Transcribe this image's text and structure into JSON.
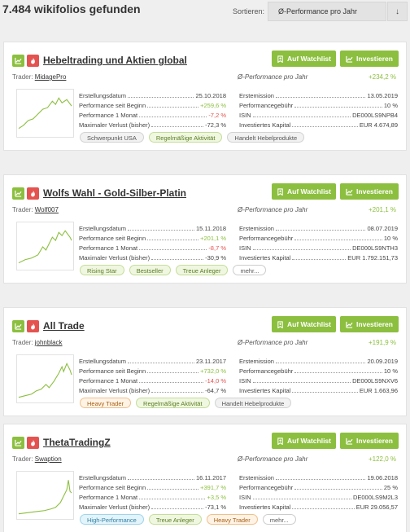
{
  "header": {
    "result_title": "7.484 wikifolios gefunden",
    "sort_label": "Sortieren:",
    "sort_value": "Ø-Performance pro Jahr"
  },
  "labels": {
    "watch": "Auf Watchlist",
    "invest": "Investieren",
    "trader": "Trader:",
    "perf_year": "Ø-Performance pro Jahr",
    "created": "Erstellungsdatum",
    "perf_start": "Performance seit Beginn",
    "perf_month": "Performance 1 Monat",
    "max_loss": "Maximaler Verlust (bisher)",
    "emission": "Erstemission",
    "fee": "Performancegebühr",
    "isin": "ISIN",
    "capital": "Investiertes Kapital"
  },
  "colors": {
    "accent": "#8cbf3f",
    "negative": "#e4534f"
  },
  "cards": [
    {
      "title": "Hebeltrading und Aktien global",
      "trader": "MidagePro",
      "perf_year": "+234,2 %",
      "created": "25.10.2018",
      "perf_start": "+259,6 %",
      "perf_month": "-7,2 %",
      "max_loss": "-72,3 %",
      "emission": "13.05.2019",
      "fee": "10 %",
      "isin": "DE000LS9NPB4",
      "capital": "EUR 4.674,89",
      "red_icon": true,
      "tags": [
        {
          "label": "Schwerpunkt USA",
          "style": "gray"
        },
        {
          "label": "Regelmäßige Aktivität",
          "style": "green"
        },
        {
          "label": "Handelt Hebelprodukte",
          "style": "gray"
        }
      ]
    },
    {
      "title": "Wolfs Wahl - Gold-Silber-Platin",
      "trader": "Wolf007",
      "perf_year": "+201,1 %",
      "created": "15.11.2018",
      "perf_start": "+201,1 %",
      "perf_month": "-8,7 %",
      "max_loss": "-30,9 %",
      "emission": "08.07.2019",
      "fee": "10 %",
      "isin": "DE000LS9NTH3",
      "capital": "EUR 1.792.151,73",
      "red_icon": true,
      "tags": [
        {
          "label": "Rising Star",
          "style": "green"
        },
        {
          "label": "Bestseller",
          "style": "green"
        },
        {
          "label": "Treue Anleger",
          "style": "green"
        },
        {
          "label": "mehr...",
          "style": "plain"
        }
      ]
    },
    {
      "title": "All Trade",
      "trader": "johnblack",
      "perf_year": "+191,9 %",
      "created": "23.11.2017",
      "perf_start": "+732,0 %",
      "perf_month": "-14,0 %",
      "max_loss": "-64,7 %",
      "emission": "20.09.2019",
      "fee": "10 %",
      "isin": "DE000LS9NXV6",
      "capital": "EUR 1.663,96",
      "red_icon": true,
      "tags": [
        {
          "label": "Heavy Trader",
          "style": "orange"
        },
        {
          "label": "Regelmäßige Aktivität",
          "style": "green"
        },
        {
          "label": "Handelt Hebelprodukte",
          "style": "gray"
        }
      ]
    },
    {
      "title": "ThetaTradingZ",
      "trader": "Swaption",
      "perf_year": "+122,0 %",
      "created": "16.11.2017",
      "perf_start": "+391,7 %",
      "perf_month": "+3,5 %",
      "max_loss": "-73,1 %",
      "emission": "19.06.2018",
      "fee": "25 %",
      "isin": "DE000LS9M2L3",
      "capital": "EUR 29.056,57",
      "red_icon": true,
      "tags": [
        {
          "label": "High-Performance",
          "style": "blue"
        },
        {
          "label": "Treue Anleger",
          "style": "green"
        },
        {
          "label": "Heavy Trader",
          "style": "orange"
        },
        {
          "label": "mehr...",
          "style": "plain"
        }
      ]
    }
  ]
}
